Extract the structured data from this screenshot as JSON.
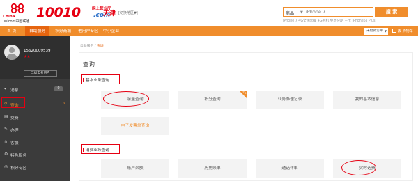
{
  "header": {
    "logo_line1": "China",
    "logo_line2": "unicom中国联通",
    "brand_number": "10010",
    "brand_sub1": "网上营业厅",
    "brand_sub2": ".com",
    "city": "天津",
    "city_switch": "[切换地区▼]",
    "search_category": "商品",
    "search_placeholder": "iPhone 7",
    "search_button": "搜 索",
    "hot_words": "iPhone 7  4G全国套餐  4G手机  免费分期  王卡 iPhone6s Plus"
  },
  "nav": {
    "items": [
      "首 页",
      "自助服务",
      "积分商城",
      "老用户专区",
      "中小企业"
    ],
    "active_index": 1,
    "cart_dropdown": "未付款订单",
    "cart_link": "去 购物车"
  },
  "sidebar": {
    "phone": "15620009539",
    "stars": "★★",
    "real_name_badge": "二级实名用户",
    "items": [
      {
        "label": "消息",
        "icon": "message-icon",
        "badge": "0"
      },
      {
        "label": "查询",
        "icon": "search-icon"
      },
      {
        "label": "交费",
        "icon": "pay-icon"
      },
      {
        "label": "办理",
        "icon": "handle-icon"
      },
      {
        "label": "客服",
        "icon": "headset-icon"
      },
      {
        "label": "特色服务",
        "icon": "special-service-icon"
      },
      {
        "label": "积分专区",
        "icon": "points-icon"
      }
    ],
    "active_index": 1
  },
  "main": {
    "breadcrumb_home": "自助服务",
    "breadcrumb_sep": "/",
    "breadcrumb_current": "查询",
    "title": "查询",
    "section1": {
      "label": "基本业务查询",
      "tiles": [
        "余量查询",
        "积分查询",
        "业务办理记录",
        "我的基本信息",
        "电子发票单查询"
      ],
      "new_badge": "NEW"
    },
    "section2": {
      "label": "消费业务查询",
      "tiles": [
        "账户余额",
        "历史账单",
        "通话详单",
        "实时话费"
      ]
    }
  },
  "colors": {
    "accent_orange": "#f08d2c",
    "brand_red": "#e60012",
    "sidebar_bg": "#3b3b3b"
  }
}
